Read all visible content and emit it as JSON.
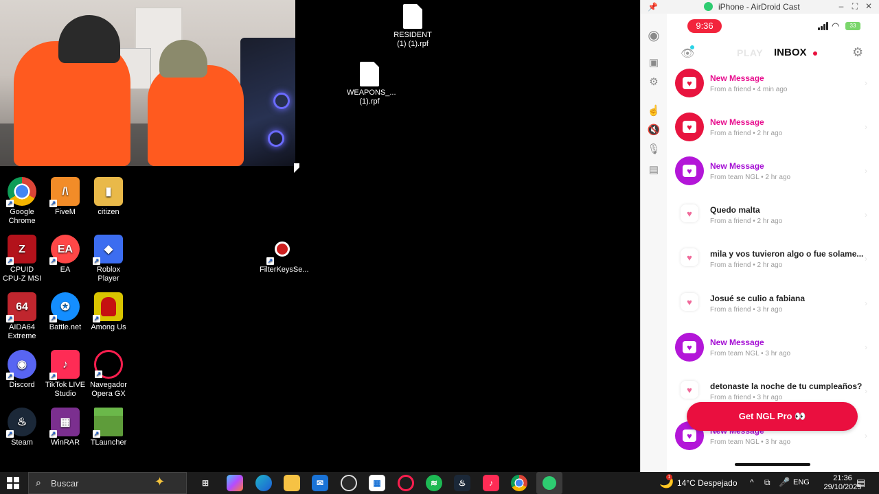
{
  "desktop": {
    "icons": [
      {
        "label": "Google Chrome",
        "icon": "chrome-icon",
        "color": "#db4437"
      },
      {
        "label": "FiveM",
        "icon": "fivem-icon",
        "color": "#f28c28"
      },
      {
        "label": "citizen",
        "icon": "folder-icon",
        "color": "#e9b949"
      },
      {
        "label": "CPUID CPU-Z MSI",
        "icon": "cpuz-icon",
        "color": "#b3121b"
      },
      {
        "label": "EA",
        "icon": "ea-icon",
        "color": "#ff4747"
      },
      {
        "label": "Roblox Player",
        "icon": "roblox-icon",
        "color": "#3c6df0"
      },
      {
        "label": "AIDA64 Extreme",
        "icon": "aida64-icon",
        "color": "#c0262e"
      },
      {
        "label": "Battle.net",
        "icon": "battlenet-icon",
        "color": "#148eff"
      },
      {
        "label": "Among Us",
        "icon": "among-us-icon",
        "color": "#c51111"
      },
      {
        "label": "Discord",
        "icon": "discord-icon",
        "color": "#5865f2"
      },
      {
        "label": "TikTok LIVE Studio",
        "icon": "tiktok-icon",
        "color": "#fe2c55"
      },
      {
        "label": "Navegador Opera GX",
        "icon": "opera-gx-icon",
        "color": "#fa1e4e"
      },
      {
        "label": "Steam",
        "icon": "steam-icon",
        "color": "#1b2838"
      },
      {
        "label": "WinRAR",
        "icon": "winrar-icon",
        "color": "#7b2f8f"
      },
      {
        "label": "TLauncher",
        "icon": "tlauncher-icon",
        "color": "#5e9c3a"
      },
      {
        "label": "FilterKeysSe...",
        "icon": "filterkeys-icon",
        "color": "#cc1f1f"
      }
    ],
    "files": [
      {
        "label": "RESIDENT (1) (1).rpf"
      },
      {
        "label": "WEAPONS_... (1).rpf"
      }
    ]
  },
  "airdroid": {
    "title": "iPhone - AirDroid Cast",
    "controls": {
      "minimize": "–",
      "maximize": "⛶",
      "close": "✕"
    }
  },
  "phone": {
    "time": "9:36",
    "battery": "33",
    "tabs": {
      "play": "PLAY",
      "inbox": "INBOX"
    },
    "messages": [
      {
        "title": "New Message",
        "sub": "From a friend • 4 min ago",
        "type": "friend"
      },
      {
        "title": "New Message",
        "sub": "From a friend • 2 hr ago",
        "type": "friend"
      },
      {
        "title": "New Message",
        "sub": "From team NGL • 2 hr ago",
        "type": "team"
      },
      {
        "title": "Quedo malta",
        "sub": "From a friend • 2 hr ago",
        "type": "read"
      },
      {
        "title": "mila y vos tuvieron algo o fue  solame...",
        "sub": "From a friend • 2 hr ago",
        "type": "read"
      },
      {
        "title": "Josué se culio a fabiana",
        "sub": "From a friend • 3 hr ago",
        "type": "read"
      },
      {
        "title": "New Message",
        "sub": "From team NGL • 3 hr ago",
        "type": "team"
      },
      {
        "title": "detonaste la noche de tu cumpleaños?",
        "sub": "From a friend • 3 hr ago",
        "type": "read"
      },
      {
        "title": "New Message",
        "sub": "From team NGL • 3 hr ago",
        "type": "team"
      }
    ],
    "pro_button": "Get NGL Pro 👀",
    "colors": {
      "friend": "#e8143f",
      "team": "#b316d8",
      "title_pink": "#e8108f",
      "title_purple": "#a50fd4"
    }
  },
  "taskbar": {
    "search_placeholder": "Buscar",
    "weather": "14°C Despejado",
    "weather_badge": "1",
    "language": "ENG",
    "time": "21:36",
    "date": "29/10/2025",
    "apps": [
      {
        "name": "task-view-icon"
      },
      {
        "name": "copilot-icon"
      },
      {
        "name": "edge-icon"
      },
      {
        "name": "file-explorer-icon"
      },
      {
        "name": "outlook-icon"
      },
      {
        "name": "obs-icon"
      },
      {
        "name": "store-icon"
      },
      {
        "name": "opera-gx-icon"
      },
      {
        "name": "spotify-icon"
      },
      {
        "name": "steam-icon"
      },
      {
        "name": "tiktok-live-icon"
      },
      {
        "name": "chrome-icon"
      },
      {
        "name": "airdroid-icon"
      }
    ]
  }
}
